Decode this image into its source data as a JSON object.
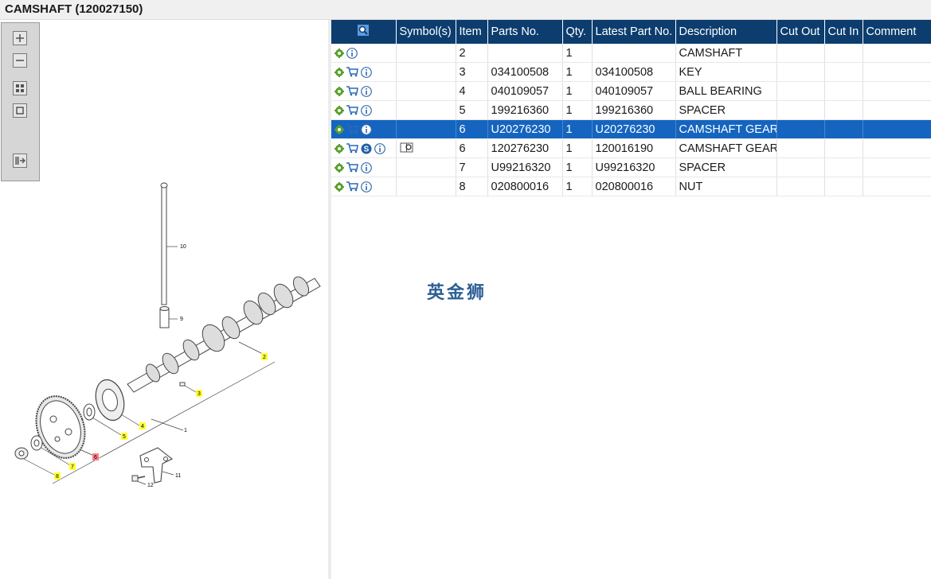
{
  "window": {
    "title": "CAMSHAFT (120027150)"
  },
  "toolbox": {
    "buttons": [
      "zoom-in",
      "zoom-out",
      "fit-all",
      "fit-page",
      "export"
    ]
  },
  "diagram": {
    "callouts": [
      "10",
      "9",
      "2",
      "3",
      "4",
      "5",
      "1",
      "6",
      "7",
      "8",
      "11",
      "12"
    ]
  },
  "table": {
    "headers": {
      "icon": "search-icon",
      "symbols": "Symbol(s)",
      "item": "Item",
      "parts_no": "Parts No.",
      "qty": "Qty.",
      "latest": "Latest Part No.",
      "description": "Description",
      "cut_out": "Cut Out",
      "cut_in": "Cut In",
      "comment": "Comment"
    },
    "rows": [
      {
        "icons": [
          "gear",
          "info"
        ],
        "symbol": "",
        "item": "2",
        "parts_no": "",
        "qty": "1",
        "latest": "",
        "description": "CAMSHAFT",
        "selected": false
      },
      {
        "icons": [
          "gear",
          "cart",
          "info"
        ],
        "symbol": "",
        "item": "3",
        "parts_no": "034100508",
        "qty": "1",
        "latest": "034100508",
        "description": "KEY",
        "selected": false
      },
      {
        "icons": [
          "gear",
          "cart",
          "info"
        ],
        "symbol": "",
        "item": "4",
        "parts_no": "040109057",
        "qty": "1",
        "latest": "040109057",
        "description": "BALL BEARING",
        "selected": false
      },
      {
        "icons": [
          "gear",
          "cart",
          "info"
        ],
        "symbol": "",
        "item": "5",
        "parts_no": "199216360",
        "qty": "1",
        "latest": "199216360",
        "description": "SPACER",
        "selected": false
      },
      {
        "icons": [
          "gear",
          "cart",
          "info"
        ],
        "symbol": "",
        "item": "6",
        "parts_no": "U20276230",
        "qty": "1",
        "latest": "U20276230",
        "description": "CAMSHAFT GEAR",
        "selected": true
      },
      {
        "icons": [
          "gear",
          "cart",
          "s-badge",
          "info"
        ],
        "symbol": "book-icon",
        "item": "6",
        "parts_no": "120276230",
        "qty": "1",
        "latest": "120016190",
        "description": "CAMSHAFT GEAR",
        "selected": false
      },
      {
        "icons": [
          "gear",
          "cart",
          "info"
        ],
        "symbol": "",
        "item": "7",
        "parts_no": "U99216320",
        "qty": "1",
        "latest": "U99216320",
        "description": "SPACER",
        "selected": false
      },
      {
        "icons": [
          "gear",
          "cart",
          "info"
        ],
        "symbol": "",
        "item": "8",
        "parts_no": "020800016",
        "qty": "1",
        "latest": "020800016",
        "description": "NUT",
        "selected": false
      }
    ]
  },
  "watermark": "英金狮",
  "colors": {
    "header": "#0c3d6e",
    "selected": "#1565c0",
    "gear": "#5aa02c",
    "cart": "#2a6ab8"
  }
}
